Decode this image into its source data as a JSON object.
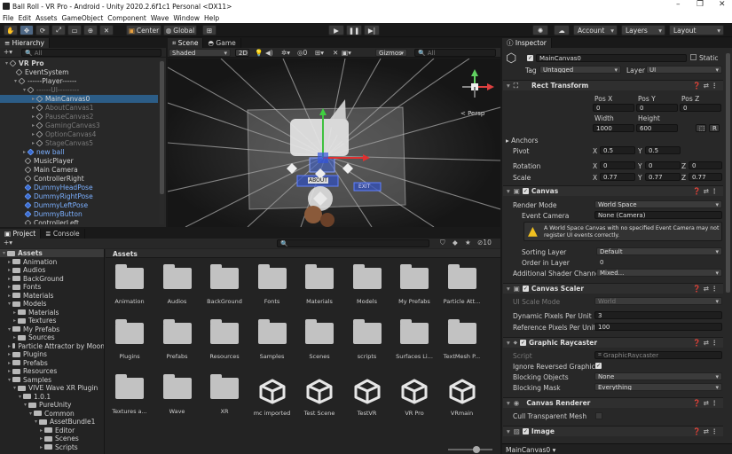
{
  "window": {
    "title": "Ball Roll - VR Pro - Android - Unity 2020.2.6f1c1 Personal <DX11>"
  },
  "menu": [
    "File",
    "Edit",
    "Assets",
    "GameObject",
    "Component",
    "Wave",
    "Window",
    "Help"
  ],
  "toolbar": {
    "center": "Center",
    "global": "Global",
    "account": "Account",
    "layers": "Layers",
    "layout": "Layout"
  },
  "hierarchy": {
    "tab": "Hierarchy",
    "search": "All",
    "items": [
      {
        "label": "VR Pro",
        "depth": 0,
        "style": "bold"
      },
      {
        "label": "EventSystem",
        "depth": 1,
        "style": ""
      },
      {
        "label": "------Player------",
        "depth": 1,
        "style": ""
      },
      {
        "label": "------UI---------",
        "depth": 2,
        "style": "dim"
      },
      {
        "label": "MainCanvas0",
        "depth": 3,
        "style": "sel"
      },
      {
        "label": "AboutCanvas1",
        "depth": 3,
        "style": "dim"
      },
      {
        "label": "PauseCanvas2",
        "depth": 3,
        "style": "dim"
      },
      {
        "label": "GamingCanvas3",
        "depth": 3,
        "style": "dim"
      },
      {
        "label": "OptionCanvas4",
        "depth": 3,
        "style": "dim"
      },
      {
        "label": "StageCanvas5",
        "depth": 3,
        "style": "dim"
      },
      {
        "label": "new ball",
        "depth": 2,
        "style": "blue"
      },
      {
        "label": "MusicPlayer",
        "depth": 2,
        "style": ""
      },
      {
        "label": "Main Camera",
        "depth": 2,
        "style": ""
      },
      {
        "label": "ControllerRight",
        "depth": 2,
        "style": ""
      },
      {
        "label": "DummyHeadPose",
        "depth": 2,
        "style": "blue"
      },
      {
        "label": "DummyRightPose",
        "depth": 2,
        "style": "blue"
      },
      {
        "label": "DummyLeftPose",
        "depth": 2,
        "style": "blue"
      },
      {
        "label": "DummyButton",
        "depth": 2,
        "style": "blue"
      },
      {
        "label": "ControllerLeft",
        "depth": 2,
        "style": ""
      }
    ]
  },
  "scene": {
    "tab_scene": "Scene",
    "tab_game": "Game",
    "shading": "Shaded",
    "mode": "2D",
    "gizmos": "Gizmos",
    "search": "All",
    "persp": "< Persp",
    "exit_label": "EXIT",
    "about_label": "ABOUT"
  },
  "project": {
    "tab_project": "Project",
    "tab_console": "Console",
    "breadcrumb": "Assets",
    "count": "10",
    "tree": [
      {
        "label": "Assets",
        "depth": 0
      },
      {
        "label": "Animation",
        "depth": 1
      },
      {
        "label": "Audios",
        "depth": 1
      },
      {
        "label": "BackGround",
        "depth": 1
      },
      {
        "label": "Fonts",
        "depth": 1
      },
      {
        "label": "Materials",
        "depth": 1
      },
      {
        "label": "Models",
        "depth": 1
      },
      {
        "label": "Materials",
        "depth": 2
      },
      {
        "label": "Textures",
        "depth": 2
      },
      {
        "label": "My Prefabs",
        "depth": 1
      },
      {
        "label": "Sources",
        "depth": 2
      },
      {
        "label": "Particle Attractor by Moon",
        "depth": 1
      },
      {
        "label": "Plugins",
        "depth": 1
      },
      {
        "label": "Prefabs",
        "depth": 1
      },
      {
        "label": "Resources",
        "depth": 1
      },
      {
        "label": "Samples",
        "depth": 1
      },
      {
        "label": "VIVE Wave XR Plugin",
        "depth": 2
      },
      {
        "label": "1.0.1",
        "depth": 3
      },
      {
        "label": "PureUnity",
        "depth": 4
      },
      {
        "label": "Common",
        "depth": 5
      },
      {
        "label": "AssetBundle1",
        "depth": 6
      },
      {
        "label": "Editor",
        "depth": 7
      },
      {
        "label": "Scenes",
        "depth": 7
      },
      {
        "label": "Scripts",
        "depth": 7
      }
    ],
    "assets": [
      {
        "label": "Animation",
        "kind": "folder"
      },
      {
        "label": "Audios",
        "kind": "folder"
      },
      {
        "label": "BackGround",
        "kind": "folder"
      },
      {
        "label": "Fonts",
        "kind": "folder"
      },
      {
        "label": "Materials",
        "kind": "folder"
      },
      {
        "label": "Models",
        "kind": "folder"
      },
      {
        "label": "My Prefabs",
        "kind": "folder"
      },
      {
        "label": "Particle Att...",
        "kind": "folder"
      },
      {
        "label": "Plugins",
        "kind": "folder"
      },
      {
        "label": "Prefabs",
        "kind": "folder"
      },
      {
        "label": "Resources",
        "kind": "folder"
      },
      {
        "label": "Samples",
        "kind": "folder"
      },
      {
        "label": "Scenes",
        "kind": "folder"
      },
      {
        "label": "scripts",
        "kind": "folder"
      },
      {
        "label": "Surfaces Li...",
        "kind": "folder"
      },
      {
        "label": "TextMesh P...",
        "kind": "folder"
      },
      {
        "label": "Textures a...",
        "kind": "folder"
      },
      {
        "label": "Wave",
        "kind": "folder"
      },
      {
        "label": "XR",
        "kind": "folder"
      },
      {
        "label": "mc imported",
        "kind": "unity"
      },
      {
        "label": "Test Scene",
        "kind": "unity"
      },
      {
        "label": "TestVR",
        "kind": "unity"
      },
      {
        "label": "VR Pro",
        "kind": "unity"
      },
      {
        "label": "VRmain",
        "kind": "unity"
      }
    ]
  },
  "inspector": {
    "tab": "Inspector",
    "name": "MainCanvas0",
    "static": "Static",
    "tag_label": "Tag",
    "tag": "Untagged",
    "layer_label": "Layer",
    "layer": "UI",
    "rect_transform": {
      "title": "Rect Transform",
      "posx_l": "Pos X",
      "posy_l": "Pos Y",
      "posz_l": "Pos Z",
      "posx": "0",
      "posy": "0",
      "posz": "0",
      "width_l": "Width",
      "height_l": "Height",
      "width": "1000",
      "height": "600",
      "r": "R",
      "anchors": "Anchors",
      "pivot": "Pivot",
      "pivot_x": "0.5",
      "pivot_y": "0.5",
      "rotation": "Rotation",
      "rot_x": "0",
      "rot_y": "0",
      "rot_z": "0",
      "scale": "Scale",
      "sc_x": "0.77",
      "sc_y": "0.77",
      "sc_z": "0.77"
    },
    "canvas": {
      "title": "Canvas",
      "render_mode_l": "Render Mode",
      "render_mode": "World Space",
      "event_camera_l": "Event Camera",
      "event_camera": "None (Camera)",
      "warning": "A World Space Canvas with no specified Event Camera may not register UI events correctly.",
      "sorting_layer_l": "Sorting Layer",
      "sorting_layer": "Default",
      "order_l": "Order in Layer",
      "order": "0",
      "shader_l": "Additional Shader Channels",
      "shader": "Mixed..."
    },
    "scaler": {
      "title": "Canvas Scaler",
      "ui_scale_l": "UI Scale Mode",
      "ui_scale": "World",
      "dyn_l": "Dynamic Pixels Per Unit",
      "dyn": "3",
      "ref_l": "Reference Pixels Per Unit",
      "ref": "100"
    },
    "raycaster": {
      "title": "Graphic Raycaster",
      "script_l": "Script",
      "script": "GraphicRaycaster",
      "ignore_l": "Ignore Reversed Graphics",
      "block_obj_l": "Blocking Objects",
      "block_obj": "None",
      "block_mask_l": "Blocking Mask",
      "block_mask": "Everything"
    },
    "renderer": {
      "title": "Canvas Renderer",
      "cull_l": "Cull Transparent Mesh"
    },
    "image": {
      "title": "Image"
    },
    "footer": "MainCanvas0"
  }
}
